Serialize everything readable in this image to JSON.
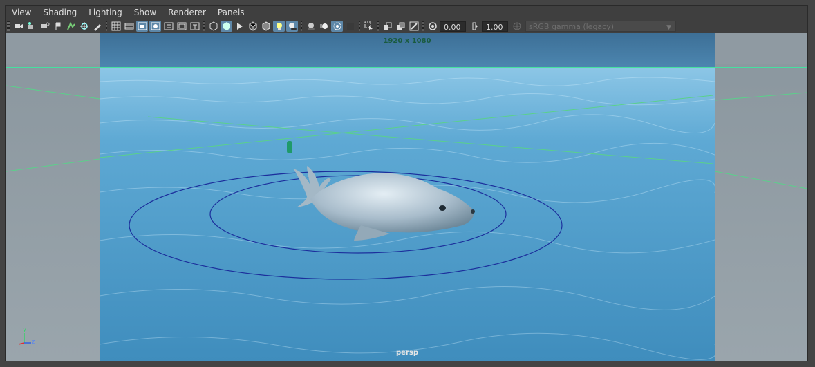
{
  "menu": [
    "View",
    "Shading",
    "Lighting",
    "Show",
    "Renderer",
    "Panels"
  ],
  "toolbar": {
    "exposure": "0.00",
    "gamma": "1.00",
    "color_space": "sRGB gamma (legacy)"
  },
  "viewport": {
    "resolution_label": "1920 x 1080",
    "camera_label": "persp",
    "axis_labels": {
      "y": "y",
      "x": "x",
      "z": "z"
    }
  },
  "colors": {
    "panel_bg": "#444444",
    "accent": "#5d87a8",
    "water": "#4f9ac4",
    "horizon_line": "#46e0a0",
    "circle": "#1c2f9c"
  }
}
